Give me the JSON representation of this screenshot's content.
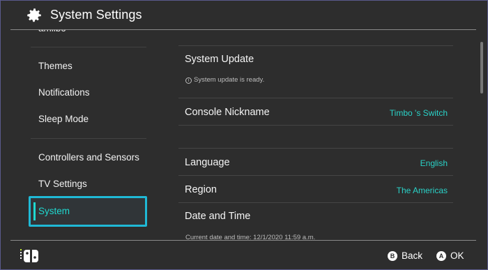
{
  "header": {
    "title": "System Settings",
    "icon": "gear-icon"
  },
  "sidebar": {
    "cut_item": "amiibo",
    "items": [
      {
        "label": "Themes"
      },
      {
        "label": "Notifications"
      },
      {
        "label": "Sleep Mode"
      },
      {
        "label": "Controllers and Sensors"
      },
      {
        "label": "TV Settings"
      },
      {
        "label": "System",
        "selected": true
      }
    ]
  },
  "main": {
    "system_update": {
      "label": "System Update",
      "status": "System update is ready."
    },
    "console_nickname": {
      "label": "Console Nickname",
      "value": "Timbo 's Switch"
    },
    "language": {
      "label": "Language",
      "value": "English"
    },
    "region": {
      "label": "Region",
      "value": "The Americas"
    },
    "date_time": {
      "label": "Date and Time",
      "current": "Current date and time: 12/1/2020 11:59 a.m."
    }
  },
  "footer": {
    "back_button_glyph": "B",
    "back_label": "Back",
    "ok_button_glyph": "A",
    "ok_label": "OK"
  },
  "colors": {
    "background": "#2d2d2d",
    "accent": "#1fd9d1",
    "selection_border": "#1fb9d6",
    "value_text": "#2ad2c8"
  }
}
